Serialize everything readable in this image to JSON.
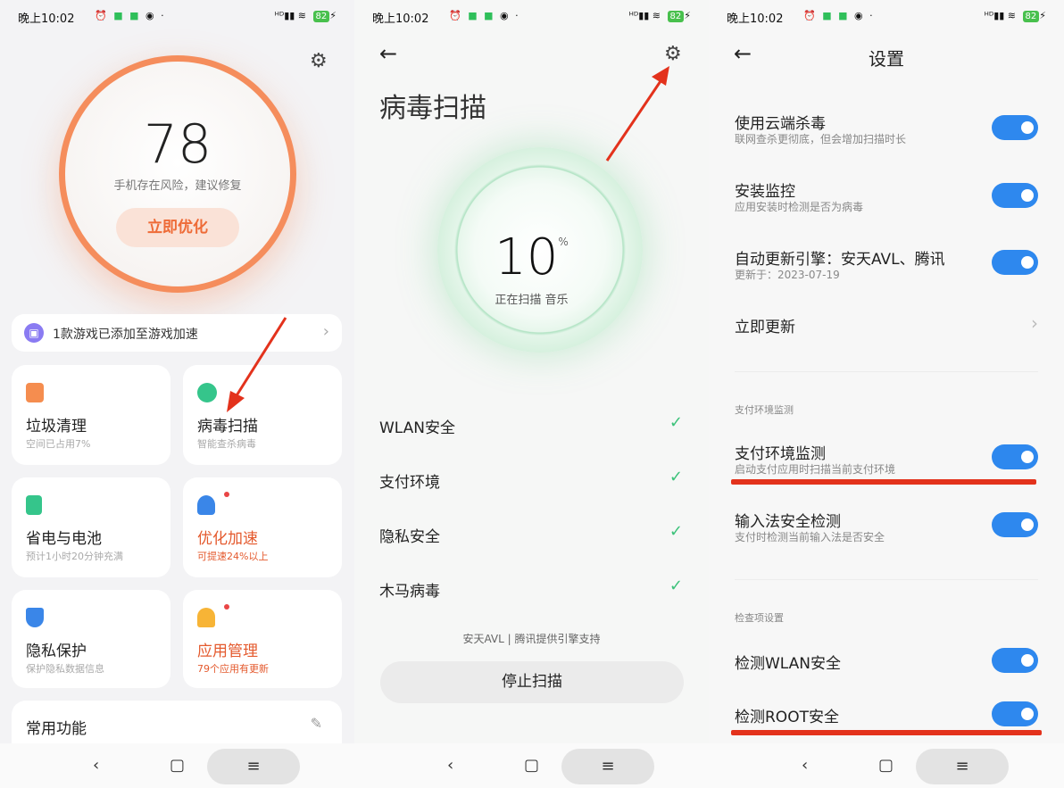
{
  "status": {
    "time": "晚上10:02",
    "battery": "82"
  },
  "screen1": {
    "score": "78",
    "score_subtitle": "手机存在风险，建议修复",
    "optimize_label": "立即优化",
    "banner_text": "1款游戏已添加至游戏加速",
    "cards": [
      {
        "title": "垃圾清理",
        "subtitle": "空间已占用7%",
        "icon": "trash-icon",
        "color": "#f58d4f",
        "highlight": false,
        "dot": false
      },
      {
        "title": "病毒扫描",
        "subtitle": "智能查杀病毒",
        "icon": "scan-icon",
        "color": "#35c58b",
        "highlight": false,
        "dot": false
      },
      {
        "title": "省电与电池",
        "subtitle": "预计1小时20分钟充满",
        "icon": "battery-icon",
        "color": "#35c58b",
        "highlight": false,
        "dot": false
      },
      {
        "title": "优化加速",
        "subtitle": "可提速24%以上",
        "icon": "rocket-icon",
        "color": "#3a86e8",
        "highlight": true,
        "dot": true
      },
      {
        "title": "隐私保护",
        "subtitle": "保护隐私数据信息",
        "icon": "shield-icon",
        "color": "#3a86e8",
        "highlight": false,
        "dot": false
      },
      {
        "title": "应用管理",
        "subtitle": "79个应用有更新",
        "icon": "android-icon",
        "color": "#f7b436",
        "highlight": true,
        "dot": true
      }
    ],
    "common_title": "常用功能"
  },
  "screen2": {
    "title": "病毒扫描",
    "progress_value": "10",
    "progress_unit": "%",
    "scanning_text": "正在扫描 音乐",
    "checks": [
      {
        "label": "WLAN安全"
      },
      {
        "label": "支付环境"
      },
      {
        "label": "隐私安全"
      },
      {
        "label": "木马病毒"
      }
    ],
    "engine_text": "安天AVL | 腾讯提供引擎支持",
    "stop_label": "停止扫描"
  },
  "screen3": {
    "title": "设置",
    "rows_top": [
      {
        "title": "使用云端杀毒",
        "subtitle": "联网查杀更彻底，但会增加扫描时长",
        "on": true
      },
      {
        "title": "安装监控",
        "subtitle": "应用安装时检测是否为病毒",
        "on": true
      },
      {
        "title": "自动更新引擎：安天AVL、腾讯",
        "subtitle": "更新于：2023-07-19",
        "on": true
      }
    ],
    "update_now": "立即更新",
    "section_payment": "支付环境监测",
    "rows_payment": [
      {
        "title": "支付环境监测",
        "subtitle": "启动支付应用时扫描当前支付环境",
        "on": true
      },
      {
        "title": "输入法安全检测",
        "subtitle": "支付时检测当前输入法是否安全",
        "on": true
      }
    ],
    "section_check": "检查项设置",
    "rows_check": [
      {
        "title": "检测WLAN安全",
        "on": true
      },
      {
        "title": "检测ROOT安全",
        "on": true
      }
    ]
  },
  "colors": {
    "accent_orange": "#f58d5c",
    "toggle_blue": "#2e88ee",
    "check_green": "#3cc27a",
    "annotation_red": "#e3321c"
  }
}
